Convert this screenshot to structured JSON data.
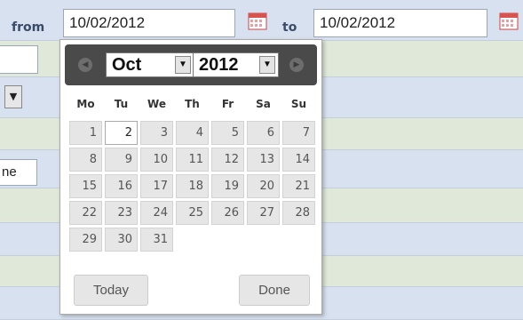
{
  "filter": {
    "from_label": "from",
    "from_value": "10/02/2012",
    "to_label": "to",
    "to_value": "10/02/2012"
  },
  "left_fields": {
    "partial_text": "ne"
  },
  "datepicker": {
    "prev_icon": "chevron-left-icon",
    "next_icon": "chevron-right-icon",
    "month": "Oct",
    "year": "2012",
    "weekdays": [
      "Mo",
      "Tu",
      "We",
      "Th",
      "Fr",
      "Sa",
      "Su"
    ],
    "days": [
      "1",
      "2",
      "3",
      "4",
      "5",
      "6",
      "7",
      "8",
      "9",
      "10",
      "11",
      "12",
      "13",
      "14",
      "15",
      "16",
      "17",
      "18",
      "19",
      "20",
      "21",
      "22",
      "23",
      "24",
      "25",
      "26",
      "27",
      "28",
      "29",
      "30",
      "31"
    ],
    "selected_day": "2",
    "today_label": "Today",
    "done_label": "Done"
  },
  "colors": {
    "row_green": "#dfe8d9",
    "row_blue": "#d8e1ef",
    "header_dark": "#4a4a4a",
    "label_blue": "#3a4b6a"
  }
}
